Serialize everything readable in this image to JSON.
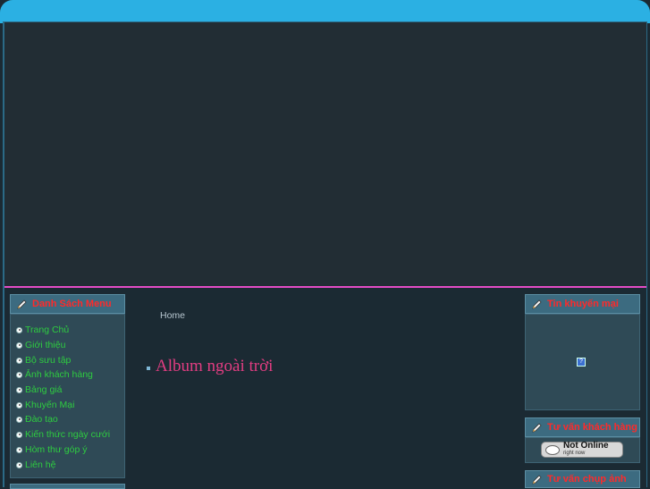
{
  "colors": {
    "accent": "#2bb0e3",
    "divider": "#e44cc6",
    "menu_link": "#2ecc40",
    "box_title": "#ff2a2a",
    "album_title": "#e23d82"
  },
  "left_menu": {
    "title": "Danh Sách Menu",
    "items": [
      "Trang Chủ",
      "Giới thiệu",
      "Bộ sưu tập",
      "Ảnh khách hàng",
      "Bảng giá",
      "Khuyến Mại",
      "Đào tạo",
      "Kiến thức ngày cưới",
      "Hòm thư góp ý",
      "Liên hệ"
    ]
  },
  "breadcrumb": "Home",
  "main": {
    "page_title": "Album ngoài trời"
  },
  "right_boxes": {
    "promo_title": "Tin khuyến mại",
    "promo_image_icon": "?",
    "consult_title": "Tư vấn khách hàng",
    "consult_status_line1": "Not Online",
    "consult_status_line2": "right now",
    "photo_title": "Tư vấn chụp ảnh"
  }
}
